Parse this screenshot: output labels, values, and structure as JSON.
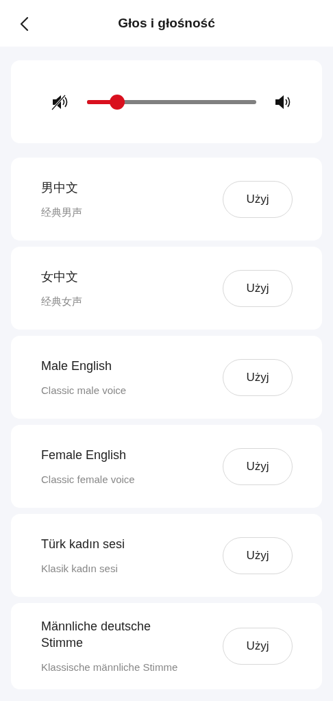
{
  "header": {
    "title": "Głos i głośność"
  },
  "volume": {
    "level": 0.18
  },
  "voices": [
    {
      "name": "男中文",
      "description": "经典男声",
      "button": "Użyj"
    },
    {
      "name": "女中文",
      "description": "经典女声",
      "button": "Użyj"
    },
    {
      "name": "Male English",
      "description": "Classic male voice",
      "button": "Użyj"
    },
    {
      "name": "Female English",
      "description": "Classic female voice",
      "button": "Użyj"
    },
    {
      "name": "Türk kadın sesi",
      "description": "Klasik kadın sesi",
      "button": "Użyj"
    },
    {
      "name": "Männliche deutsche Stimme",
      "description": "Klassische männliche Stimme",
      "button": "Użyj"
    }
  ]
}
